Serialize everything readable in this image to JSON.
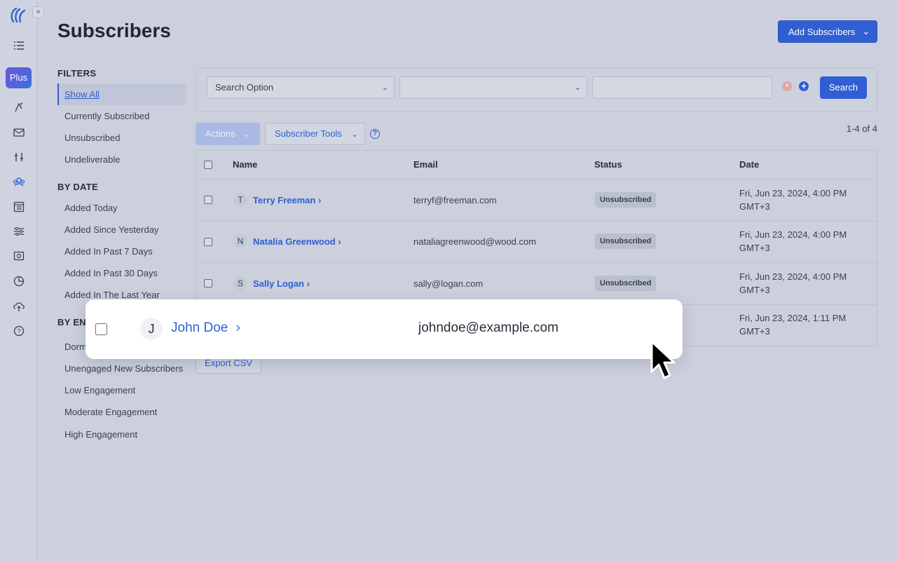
{
  "page": {
    "title": "Subscribers",
    "add_button": "Add Subscribers"
  },
  "rail": {
    "plus_label": "Plus"
  },
  "filters": {
    "sections": [
      {
        "heading": "FILTERS",
        "items": [
          "Show All",
          "Currently Subscribed",
          "Unsubscribed",
          "Undeliverable"
        ]
      },
      {
        "heading": "BY DATE",
        "items": [
          "Added Today",
          "Added Since Yesterday",
          "Added In Past 7 Days",
          "Added In Past 30 Days",
          "Added In The Last Year"
        ]
      },
      {
        "heading": "BY ENG",
        "items": [
          "Dorm",
          "Unengaged New Subscribers",
          "Low Engagement",
          "Moderate Engagement",
          "High Engagement"
        ]
      }
    ],
    "active": "Show All"
  },
  "search": {
    "option_label": "Search Option",
    "second_select": "",
    "text_value": "",
    "button": "Search"
  },
  "toolbar": {
    "actions": "Actions",
    "tools": "Subscriber Tools",
    "count": "1-4 of 4"
  },
  "table": {
    "columns": [
      "Name",
      "Email",
      "Status",
      "Date"
    ],
    "rows": [
      {
        "initial": "T",
        "name": "Terry Freeman",
        "email": "terryf@freeman.com",
        "status": "Unsubscribed",
        "date1": "Fri, Jun 23, 2024, 4:00 PM",
        "date2": "GMT+3"
      },
      {
        "initial": "N",
        "name": "Natalia Greenwood",
        "email": "nataliagreenwood@wood.com",
        "status": "Unsubscribed",
        "date1": "Fri, Jun 23, 2024, 4:00 PM",
        "date2": "GMT+3"
      },
      {
        "initial": "S",
        "name": "Sally Logan",
        "email": "sally@logan.com",
        "status": "Unsubscribed",
        "date1": "Fri, Jun 23, 2024, 4:00 PM",
        "date2": "GMT+3"
      },
      {
        "initial": "J",
        "name": "John Doe",
        "email": "johndoe@example.com",
        "status": "",
        "date1": "Fri, Jun 23, 2024, 1:11 PM",
        "date2": "GMT+3"
      }
    ],
    "export": "Export CSV"
  },
  "highlight": {
    "initial": "J",
    "name": "John Doe",
    "email": "johndoe@example.com"
  },
  "colors": {
    "accent": "#2f5fd2",
    "background": "#ccd0dd"
  }
}
